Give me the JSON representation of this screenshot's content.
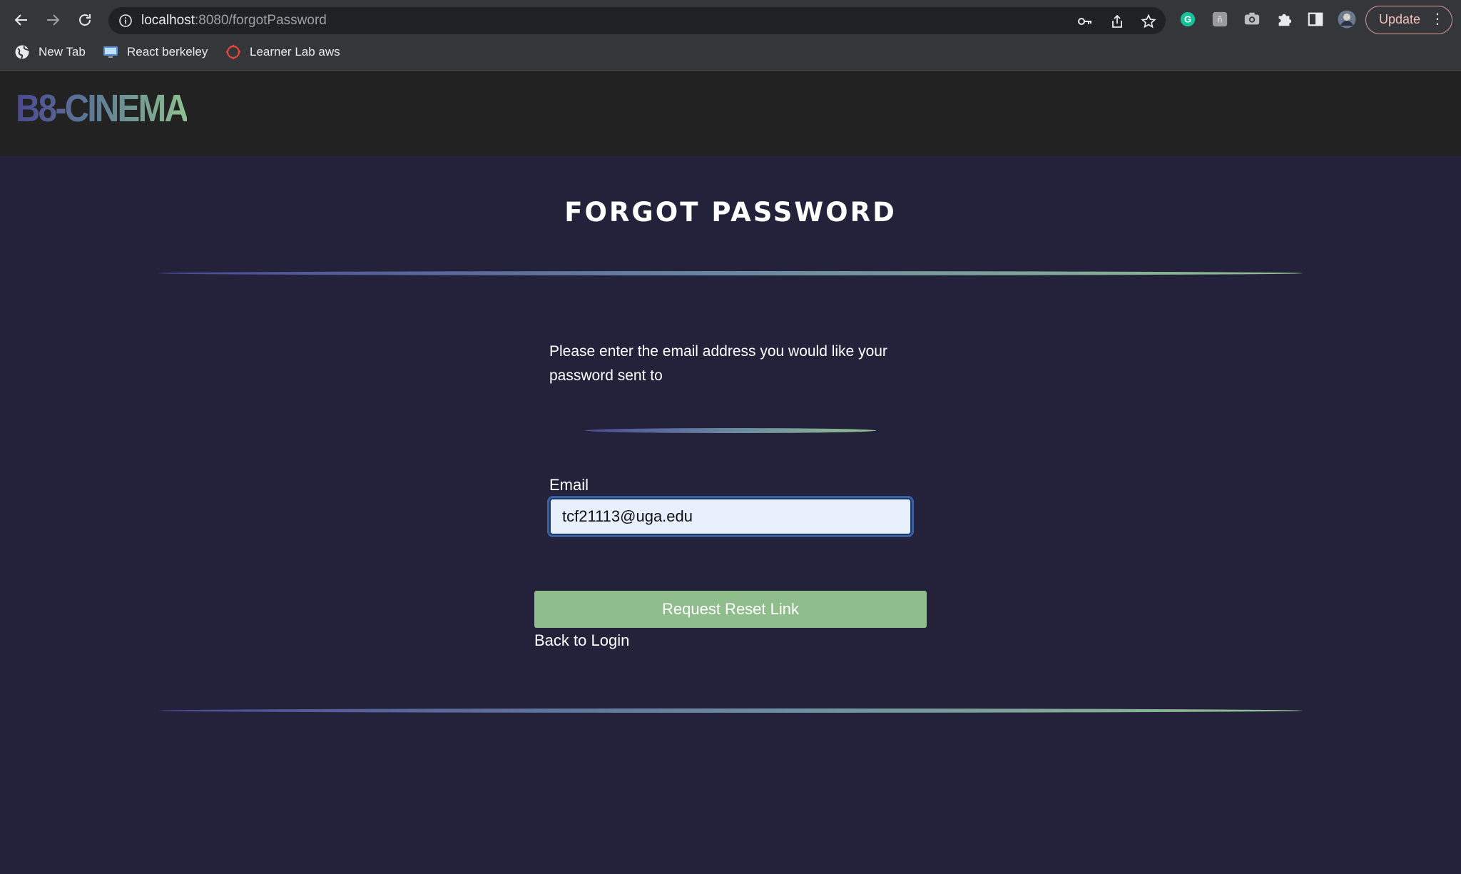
{
  "browser": {
    "url_host": "localhost",
    "url_path": ":8080/forgotPassword",
    "update_label": "Update",
    "menu_glyph": "⋮",
    "nav_icons": [
      "back-arrow-icon",
      "forward-arrow-icon",
      "reload-icon"
    ],
    "omnibox_icons": [
      "key-icon",
      "share-icon",
      "star-icon"
    ],
    "extension_icons": [
      "grammarly-icon",
      "extension-icon",
      "camera-icon",
      "puzzle-icon",
      "side-panel-icon",
      "profile-avatar"
    ],
    "bookmarks": [
      {
        "label": "New Tab",
        "icon": "globe-icon"
      },
      {
        "label": "React berkeley",
        "icon": "monitor-icon"
      },
      {
        "label": "Learner Lab aws",
        "icon": "canvas-icon"
      }
    ]
  },
  "site": {
    "logo_text": "B8-CINEMA"
  },
  "page": {
    "title": "FORGOT PASSWORD",
    "instructions": "Please enter the email address you would like your password sent to",
    "email_label": "Email",
    "email_value": "tcf21113@uga.edu",
    "submit_label": "Request Reset Link",
    "back_link": "Back to Login"
  },
  "colors": {
    "page_bg": "#23223a",
    "header_bg": "#222222",
    "button_bg": "#90bd8c",
    "gradient_start": "#4b4a98",
    "gradient_end": "#93c090"
  }
}
